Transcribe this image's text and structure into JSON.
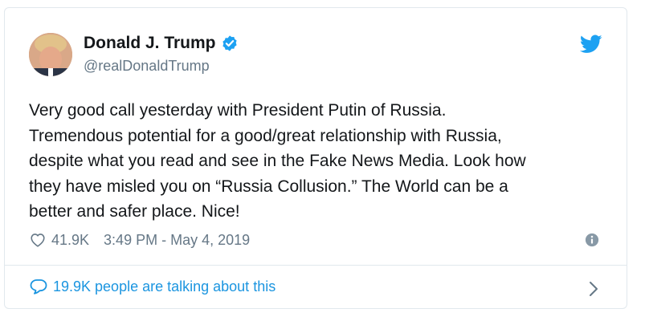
{
  "user": {
    "display_name": "Donald J. Trump",
    "handle": "@realDonaldTrump",
    "verified": true
  },
  "tweet": {
    "text": "Very good call yesterday with President Putin of Russia.\nTremendous potential for a good/great relationship with Russia,\ndespite what you read and see in the Fake News Media. Look how\nthey have misled you on “Russia Collusion.” The World can be a\nbetter and safer place. Nice!",
    "likes": "41.9K",
    "timestamp": "3:49 PM - May 4, 2019"
  },
  "footer": {
    "talking_text": "19.9K people are talking about this"
  },
  "icons": {
    "brand": "twitter-bird-icon",
    "verified": "verified-badge-icon",
    "like": "heart-icon",
    "info": "info-icon",
    "conversation": "speech-bubble-icon",
    "chevron": "chevron-right-icon"
  },
  "colors": {
    "accent": "#1da1f2",
    "link": "#1b95e0",
    "text": "#14171a",
    "muted": "#657786",
    "border": "#e1e8ed"
  }
}
